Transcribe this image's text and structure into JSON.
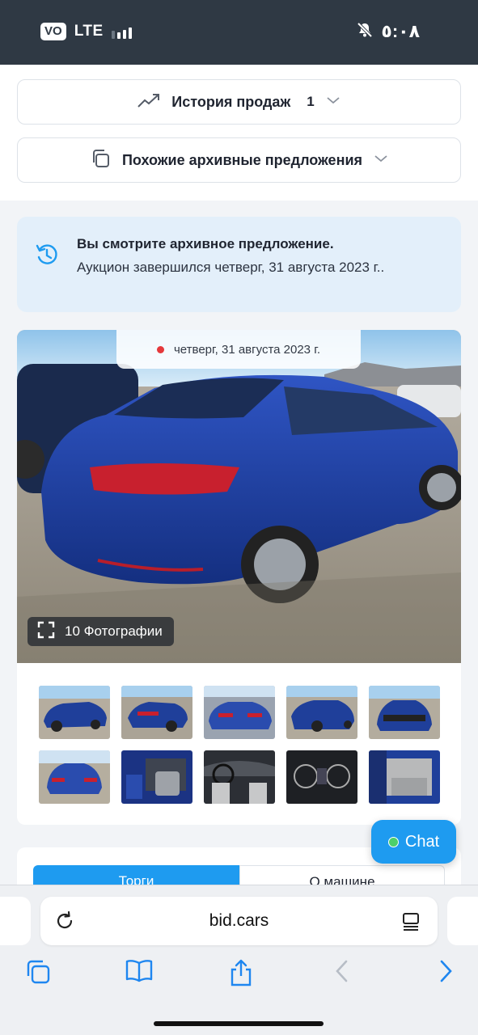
{
  "status_bar": {
    "carrier_badge": "VO",
    "network": "LTE",
    "time": "٥:٠٨"
  },
  "sales_history": {
    "label": "История продаж",
    "count": "1"
  },
  "similar_offers": {
    "label": "Похожие архивные предложения"
  },
  "archive_notice": {
    "title": "Вы смотрите архивное предложение.",
    "text": "Аукцион завершился четверг, 31 августа 2023 г.."
  },
  "gallery": {
    "date": "четверг, 31 августа 2023 г.",
    "photo_count_label": "10 Фотографии",
    "thumbnails": [
      {
        "view": "front-left"
      },
      {
        "view": "rear-right"
      },
      {
        "view": "rear"
      },
      {
        "view": "front-right"
      },
      {
        "view": "front"
      },
      {
        "view": "rear-left"
      },
      {
        "view": "interior-front"
      },
      {
        "view": "dashboard"
      },
      {
        "view": "instrument-cluster"
      },
      {
        "view": "rear-seats"
      }
    ]
  },
  "chat": {
    "label": "Chat"
  },
  "tabs": [
    {
      "label": "Торги"
    },
    {
      "label": "О машине"
    }
  ],
  "browser": {
    "url": "bid.cars"
  },
  "colors": {
    "accent": "#1e9bf0",
    "status_bar_bg": "#2f3944",
    "banner_bg": "#e3effa",
    "car_blue": "#1f3f9a"
  }
}
